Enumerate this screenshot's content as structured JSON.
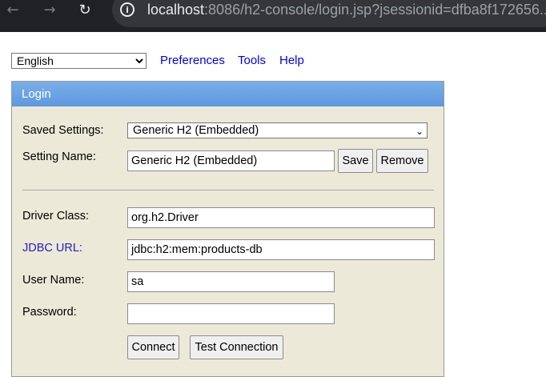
{
  "browser": {
    "back_icon": "back-arrow-icon",
    "forward_icon": "forward-arrow-icon",
    "reload_icon": "reload-icon",
    "info_icon": "info-icon",
    "url_host": "localhost",
    "url_rest": ":8086/h2-console/login.jsp?jsessionid=dfba8f172656..."
  },
  "toolbar": {
    "language": "English",
    "preferences": "Preferences",
    "tools": "Tools",
    "help": "Help"
  },
  "login": {
    "title": "Login",
    "saved_settings_label": "Saved Settings:",
    "saved_settings_value": "Generic H2 (Embedded)",
    "setting_name_label": "Setting Name:",
    "setting_name_value": "Generic H2 (Embedded)",
    "save_button": "Save",
    "remove_button": "Remove",
    "driver_class_label": "Driver Class:",
    "driver_class_value": "org.h2.Driver",
    "jdbc_url_label": "JDBC URL:",
    "jdbc_url_value": "jdbc:h2:mem:products-db",
    "user_name_label": "User Name:",
    "user_name_value": "sa",
    "password_label": "Password:",
    "password_value": "",
    "connect_button": "Connect",
    "test_connection_button": "Test Connection"
  },
  "colors": {
    "chrome_bg": "#202124",
    "header_blue": "#6aa2e4",
    "panel_bg": "#ece9d8",
    "link_blue": "#0000ee"
  }
}
